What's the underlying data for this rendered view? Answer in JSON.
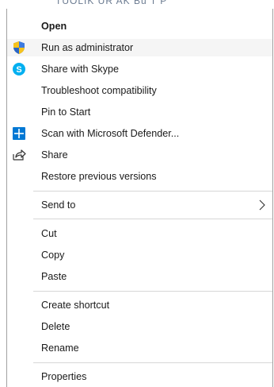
{
  "background": {
    "partial_text": "TUOLIK UR AK  Bu T P"
  },
  "menu": {
    "items": [
      {
        "label": "Open"
      },
      {
        "label": "Run as administrator",
        "icon": "uac-shield-icon"
      },
      {
        "label": "Share with Skype",
        "icon": "skype-icon"
      },
      {
        "label": "Troubleshoot compatibility"
      },
      {
        "label": "Pin to Start"
      },
      {
        "label": "Scan with Microsoft Defender...",
        "icon": "defender-icon"
      },
      {
        "label": "Share",
        "icon": "share-icon"
      },
      {
        "label": "Restore previous versions"
      },
      {
        "label": "Send to",
        "submenu_arrow": "chevron-right-icon"
      },
      {
        "label": "Cut"
      },
      {
        "label": "Copy"
      },
      {
        "label": "Paste"
      },
      {
        "label": "Create shortcut"
      },
      {
        "label": "Delete"
      },
      {
        "label": "Rename"
      },
      {
        "label": "Properties"
      }
    ],
    "highlighted_item": "Run as administrator"
  },
  "colors": {
    "menu_background": "#ffffff",
    "hover_background": "#f5f5f5",
    "separator": "#d7d7d7",
    "border": "#a0a0a0",
    "text": "#1a1a1a",
    "skype_blue": "#00aff0",
    "defender_blue": "#0078d4",
    "shield_yellow": "#f7c31d",
    "shield_blue": "#2a66c6"
  }
}
